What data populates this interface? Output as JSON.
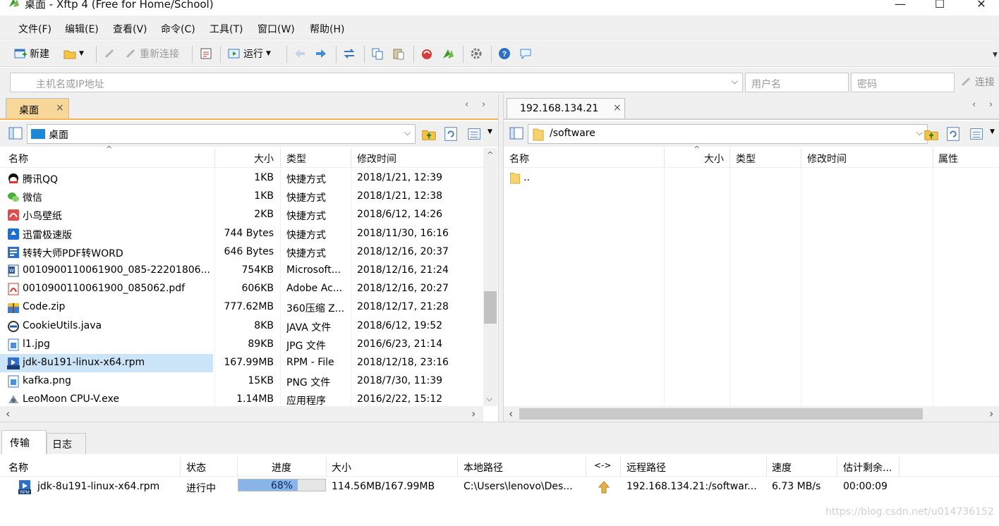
{
  "window": {
    "title": "桌面 - Xftp 4 (Free for Home/School)"
  },
  "menu": [
    "文件(F)",
    "编辑(E)",
    "查看(V)",
    "命令(C)",
    "工具(T)",
    "窗口(W)",
    "帮助(H)"
  ],
  "toolbar": {
    "new": "新建",
    "reconnect": "重新连接",
    "run": "运行"
  },
  "address": {
    "host_placeholder": "主机名或IP地址",
    "user_placeholder": "用户名",
    "password_placeholder": "密码",
    "connect": "连接"
  },
  "left": {
    "tab": "桌面",
    "path": "桌面",
    "columns": [
      "名称",
      "大小",
      "类型",
      "修改时间"
    ],
    "rows": [
      {
        "name": "腾讯QQ",
        "size": "1KB",
        "type": "快捷方式",
        "mtime": "2018/1/21, 12:39",
        "icon": "qq-icon"
      },
      {
        "name": "微信",
        "size": "1KB",
        "type": "快捷方式",
        "mtime": "2018/1/21, 12:38",
        "icon": "wechat-icon"
      },
      {
        "name": "小鸟壁纸",
        "size": "2KB",
        "type": "快捷方式",
        "mtime": "2018/6/12, 14:26",
        "icon": "bird-icon"
      },
      {
        "name": "迅雷极速版",
        "size": "744 Bytes",
        "type": "快捷方式",
        "mtime": "2018/11/30, 16:16",
        "icon": "thunder-icon"
      },
      {
        "name": "转转大师PDF转WORD",
        "size": "646 Bytes",
        "type": "快捷方式",
        "mtime": "2018/12/16, 20:37",
        "icon": "pdf-convert-icon"
      },
      {
        "name": "0010900110061900_085-22201806...",
        "size": "754KB",
        "type": "Microsoft...",
        "mtime": "2018/12/16, 21:24",
        "icon": "word-doc-icon"
      },
      {
        "name": "0010900110061900_085062.pdf",
        "size": "606KB",
        "type": "Adobe Ac...",
        "mtime": "2018/12/16, 20:27",
        "icon": "pdf-icon"
      },
      {
        "name": "Code.zip",
        "size": "777.62MB",
        "type": "360压缩 Z...",
        "mtime": "2018/12/17, 21:28",
        "icon": "zip-icon"
      },
      {
        "name": "CookieUtils.java",
        "size": "8KB",
        "type": "JAVA 文件",
        "mtime": "2018/6/12, 19:52",
        "icon": "java-icon"
      },
      {
        "name": "l1.jpg",
        "size": "89KB",
        "type": "JPG 文件",
        "mtime": "2016/6/23, 21:14",
        "icon": "image-icon"
      },
      {
        "name": "jdk-8u191-linux-x64.rpm",
        "size": "167.99MB",
        "type": "RPM - File",
        "mtime": "2018/12/18, 23:16",
        "icon": "rpm-icon",
        "selected": true
      },
      {
        "name": "kafka.png",
        "size": "15KB",
        "type": "PNG 文件",
        "mtime": "2018/7/30, 11:39",
        "icon": "image-icon"
      },
      {
        "name": "LeoMoon CPU-V.exe",
        "size": "1.14MB",
        "type": "应用程序",
        "mtime": "2016/2/22, 15:12",
        "icon": "exe-icon"
      }
    ]
  },
  "right": {
    "tab": "192.168.134.21",
    "path": "/software",
    "columns": [
      "名称",
      "大小",
      "类型",
      "修改时间",
      "属性"
    ],
    "rows": [
      {
        "name": ".."
      }
    ]
  },
  "bottom": {
    "tabs": [
      "传输",
      "日志"
    ],
    "columns": [
      "名称",
      "状态",
      "进度",
      "大小",
      "本地路径",
      "<->",
      "远程路径",
      "速度",
      "估计剩余..."
    ],
    "transfers": [
      {
        "name": "jdk-8u191-linux-x64.rpm",
        "status": "进行中",
        "progress": 0.68,
        "progress_label": "68%",
        "size": "114.56MB/167.99MB",
        "local": "C:\\Users\\lenovo\\Des...",
        "remote": "192.168.134.21:/softwar...",
        "speed": "6.73 MB/s",
        "eta": "00:00:09"
      }
    ]
  },
  "watermark": "https://blog.csdn.net/u014736152"
}
